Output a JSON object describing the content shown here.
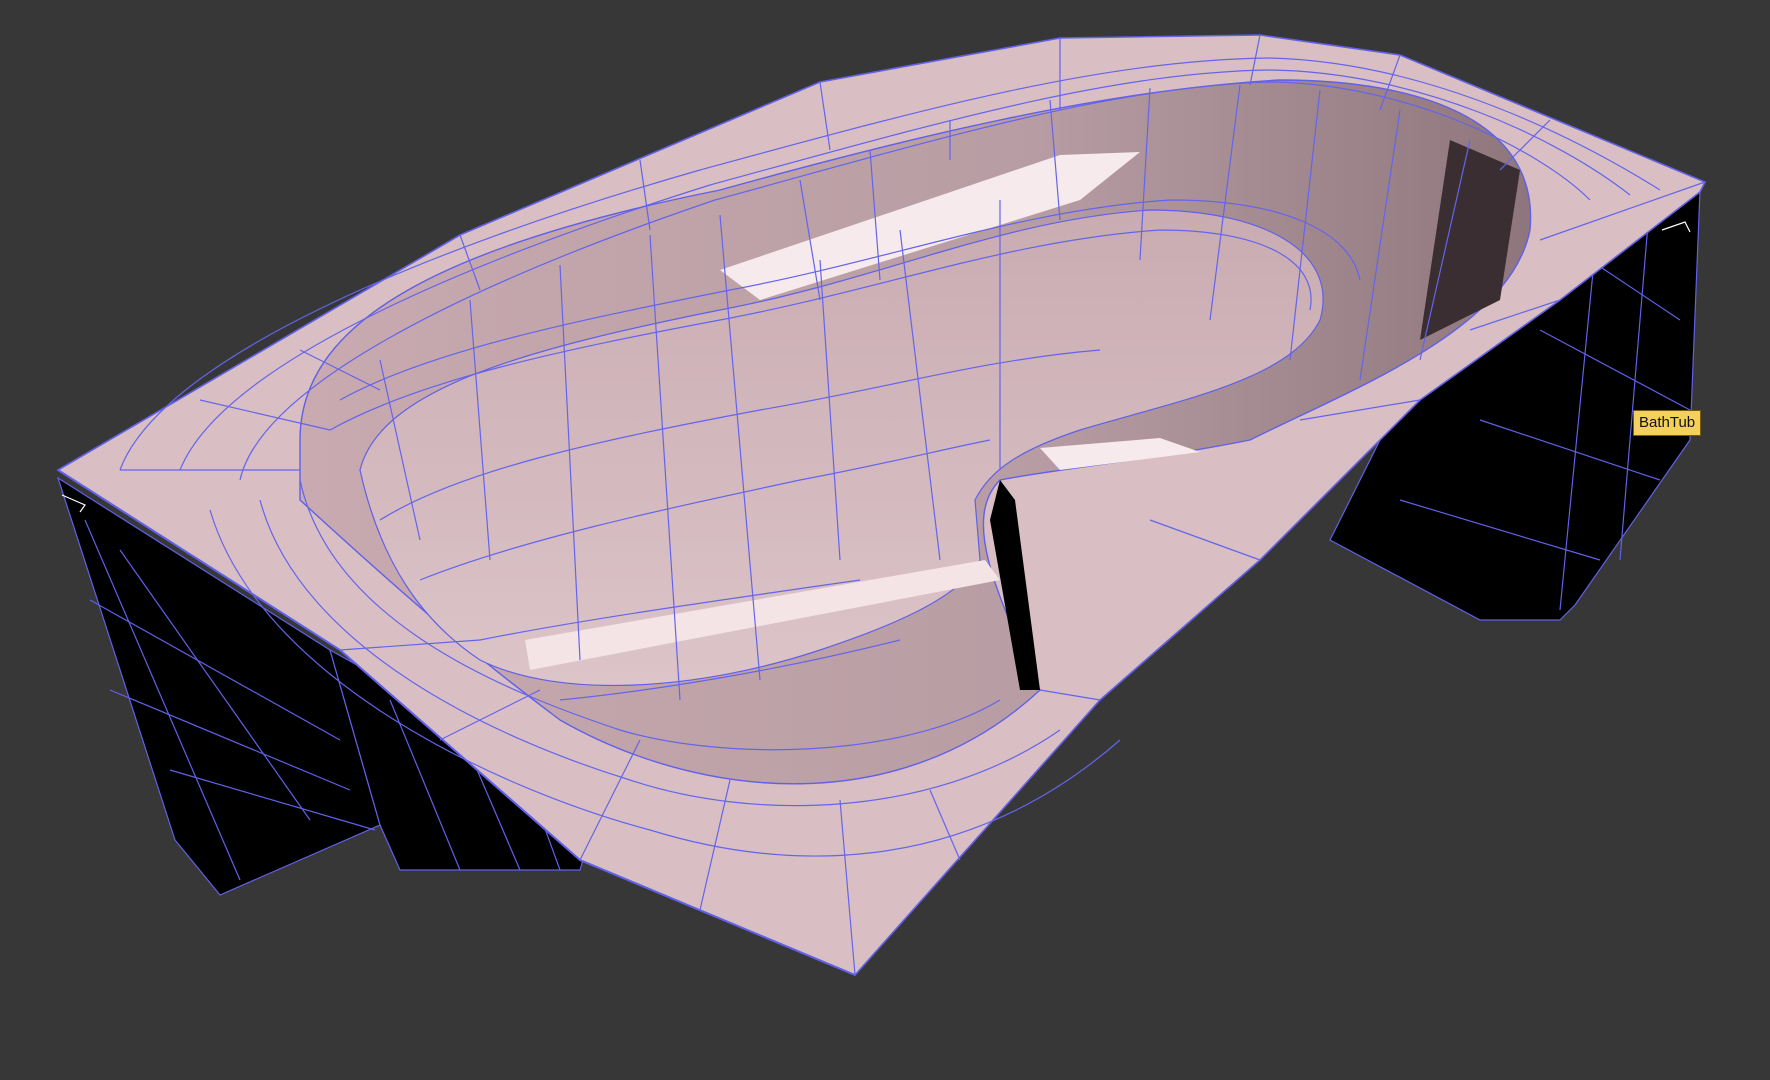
{
  "viewport": {
    "background": "#373737",
    "object": {
      "name": "BathTub",
      "surface_color": "#d8bcc0",
      "wire_color": "#6060e8",
      "shadow_color": "#000000"
    }
  }
}
